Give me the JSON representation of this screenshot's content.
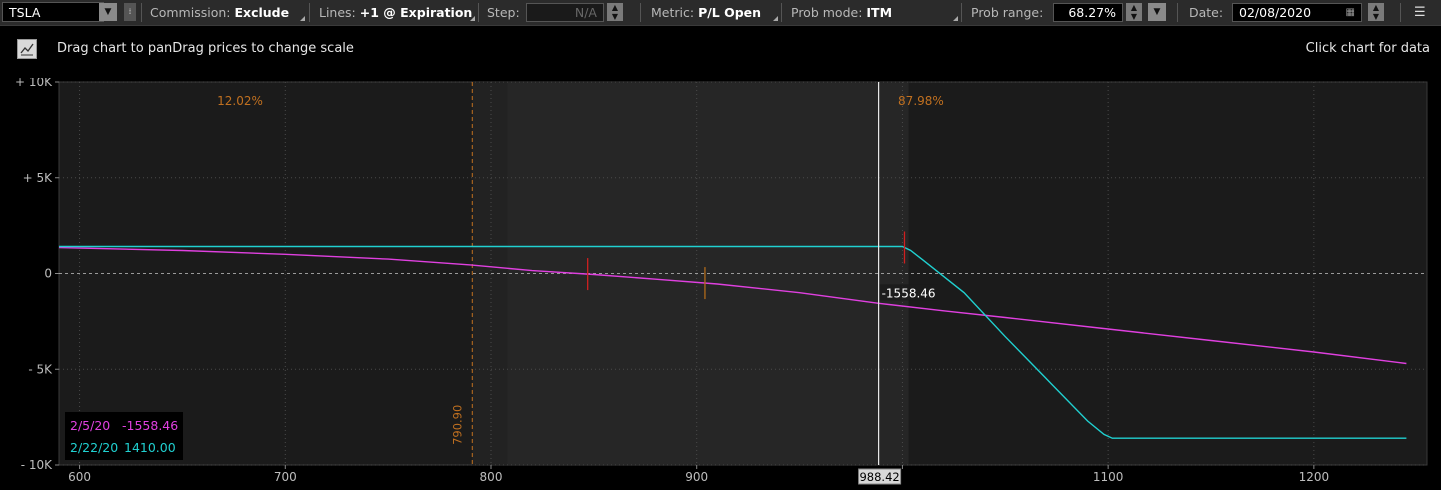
{
  "toolbar": {
    "symbol": "TSLA",
    "commission_label": "Commission:",
    "commission_value": "Exclude",
    "lines_label": "Lines:",
    "lines_value": "+1 @ Expiration",
    "step_label": "Step:",
    "step_value": "N/A",
    "metric_label": "Metric:",
    "metric_value": "P/L Open",
    "probmode_label": "Prob mode:",
    "probmode_value": "ITM",
    "probrange_label": "Prob range:",
    "probrange_value": "68.27%",
    "date_label": "Date:",
    "date_value": "02/08/2020"
  },
  "subbar": {
    "hint_left": "Drag chart to panDrag prices to change scale",
    "hint_right": "Click chart for data"
  },
  "chart_data": {
    "type": "line",
    "xlim": [
      590,
      1255
    ],
    "ylim": [
      -10000,
      10000
    ],
    "x_ticks": [
      600,
      700,
      800,
      900,
      1000,
      1100,
      1200
    ],
    "x_tick_labels": [
      "600",
      "700",
      "800",
      "900",
      "",
      "1100",
      "1200"
    ],
    "y_ticks": [
      10000,
      5000,
      0,
      -5000,
      -10000
    ],
    "y_tick_labels": [
      "+ 10K",
      "+ 5K",
      "0",
      "- 5K",
      "- 10K"
    ],
    "grid": true,
    "prob_range": [
      808,
      1003
    ],
    "cursor": {
      "x": 988.42,
      "label": "988.42",
      "value_label": "-1558.46"
    },
    "breakeven": {
      "x": 790.9,
      "label": "790.90"
    },
    "prob_labels": [
      {
        "text": "12.02%",
        "x": 678,
        "y": 8800
      },
      {
        "text": "87.98%",
        "x": 1009,
        "y": 8800
      }
    ],
    "markers": [
      {
        "x": 847,
        "series": 0,
        "color": "#d02020"
      },
      {
        "x": 1001,
        "series": 1,
        "color": "#d02020"
      },
      {
        "x": 904,
        "series": 0,
        "color": "#b06a1a"
      }
    ],
    "series": [
      {
        "name": "2/5/20",
        "color": "#e040e0",
        "legend_value": "-1558.46",
        "x": [
          590,
          650,
          700,
          750,
          790,
          820,
          850,
          880,
          910,
          950,
          988.42,
          1020,
          1050,
          1100,
          1150,
          1200,
          1245
        ],
        "y": [
          1350,
          1200,
          1000,
          750,
          450,
          150,
          -50,
          -300,
          -550,
          -1000,
          -1558,
          -1950,
          -2300,
          -2900,
          -3500,
          -4100,
          -4700
        ]
      },
      {
        "name": "2/22/20",
        "color": "#20d0d0",
        "legend_value": "1410.00",
        "x": [
          590,
          900,
          1000,
          1004,
          1010,
          1030,
          1050,
          1070,
          1090,
          1098,
          1102,
          1245
        ],
        "y": [
          1410,
          1410,
          1410,
          1200,
          700,
          -1000,
          -3300,
          -5500,
          -7700,
          -8400,
          -8600,
          -8600
        ]
      }
    ]
  }
}
